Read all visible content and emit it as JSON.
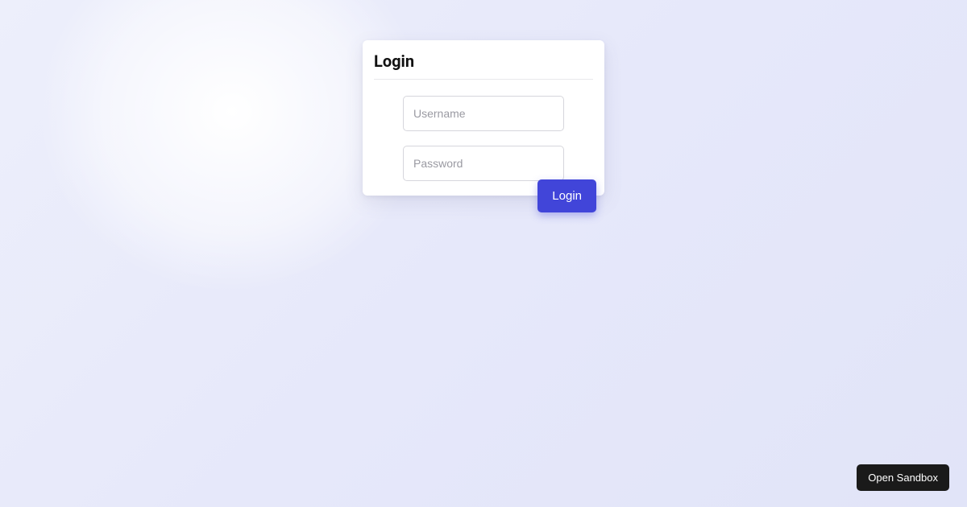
{
  "card": {
    "title": "Login"
  },
  "form": {
    "username_placeholder": "Username",
    "username_value": "",
    "password_placeholder": "Password",
    "password_value": ""
  },
  "buttons": {
    "login_label": "Login",
    "sandbox_label": "Open Sandbox"
  },
  "colors": {
    "primary": "#4145d9",
    "card_bg": "#ffffff",
    "page_bg_start": "#edeffb",
    "page_bg_end": "#e1e4f8"
  }
}
